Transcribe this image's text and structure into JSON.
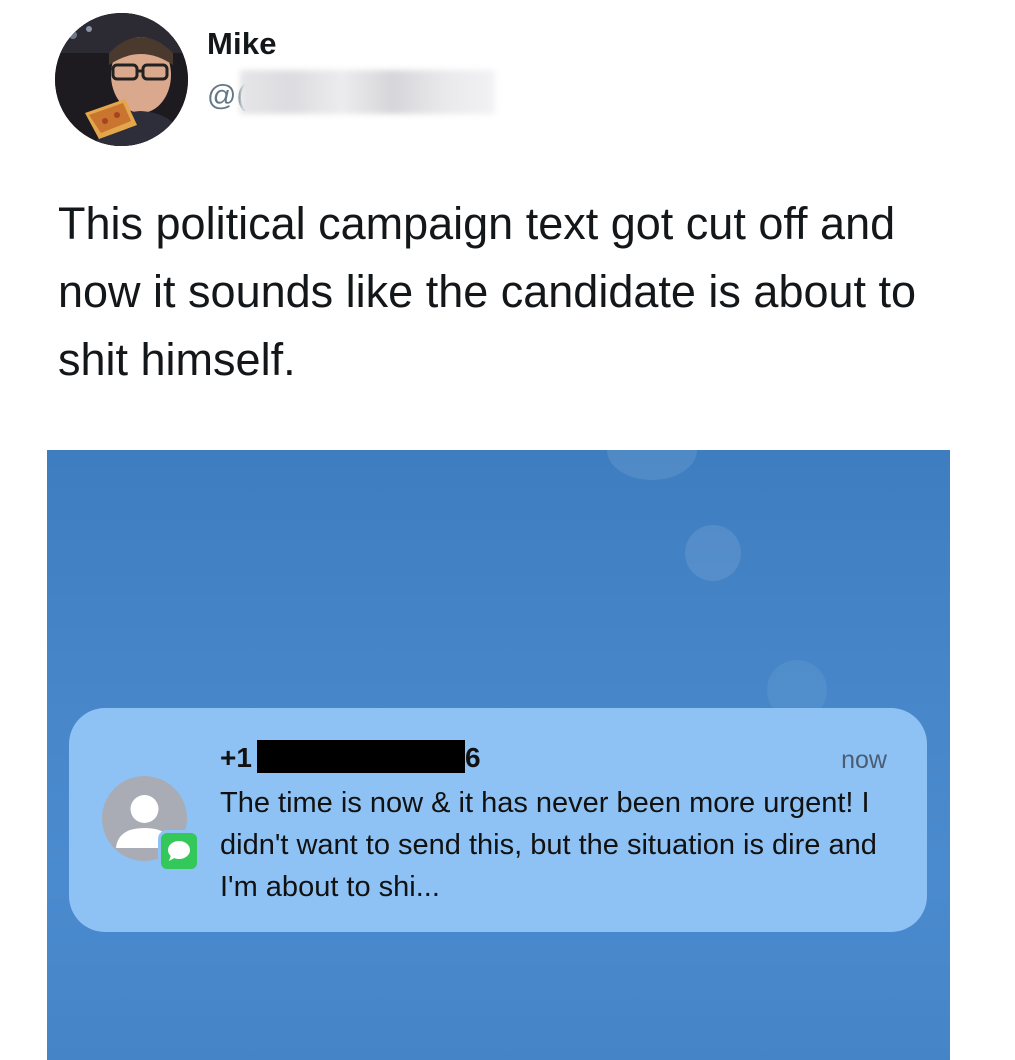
{
  "tweet": {
    "display_name": "Mike",
    "handle": "@(",
    "text": "This political campaign text got cut off and now it sounds like the candidate is about to shit himself."
  },
  "notification": {
    "sender_prefix": "+1",
    "sender_suffix": "6",
    "time": "now",
    "message": "The time is now & it has never been more urgent! I didn't want to send this, but the situation is dire and I'm about to shi...",
    "badge_color": "#34c759",
    "card_color": "#8ec2f5",
    "background_color": "#4787c9"
  },
  "icons": {
    "contact": "person-silhouette-icon",
    "app": "messages-bubble-icon"
  }
}
